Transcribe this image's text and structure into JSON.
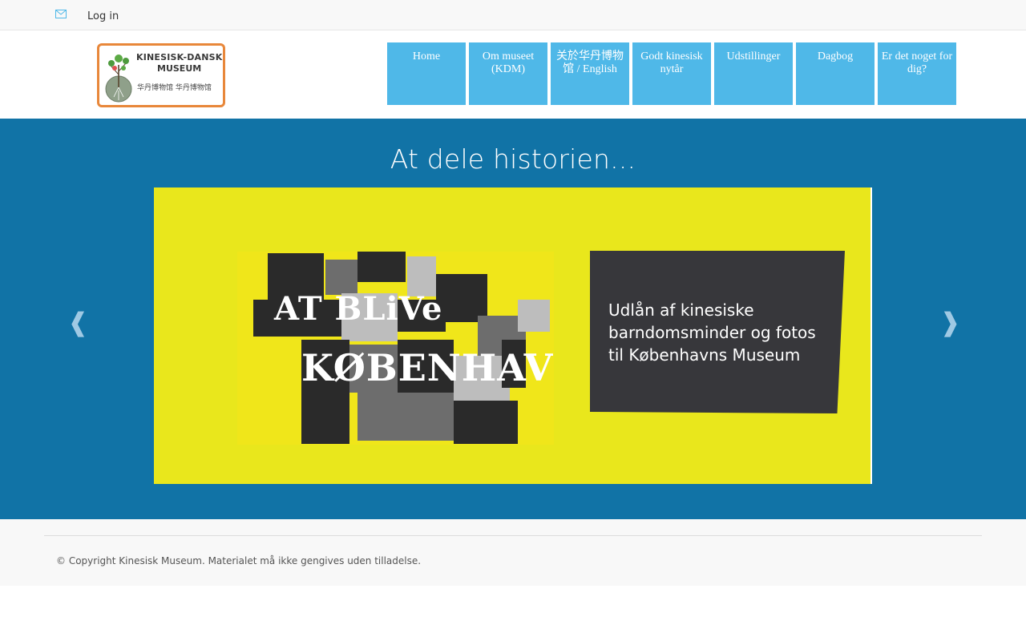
{
  "topbar": {
    "mail_icon": "envelope-icon",
    "login_label": "Log in"
  },
  "header": {
    "logo": {
      "line1": "KINESISK-DANSK",
      "line2": "MUSEUM",
      "line3": "华丹博物馆  华丹博物馆",
      "icon": "tree-icon"
    },
    "nav": [
      {
        "label": "Home"
      },
      {
        "label": "Om museet (KDM)"
      },
      {
        "label": "关於华丹博物馆 / English"
      },
      {
        "label": "Godt kinesisk nytår"
      },
      {
        "label": "Udstillinger"
      },
      {
        "label": "Dagbog"
      },
      {
        "label": "Er det noget for dig?"
      }
    ]
  },
  "hero": {
    "title": "At dele historien...",
    "prev_arrow": "❰",
    "next_arrow": "❱",
    "slide": {
      "collage_line1": "AT BLiVe",
      "collage_line2": "KØBENHAVNER",
      "panel_text": "Udlån af kinesiske\nbarndomsminder og fotos\ntil Københavns Museum"
    }
  },
  "footer": {
    "copyright": "© Copyright Kinesisk Museum. Materialet må ikke gengives uden tilladelse."
  },
  "colors": {
    "nav_bg": "#4fb8e8",
    "hero_bg": "#1173a6",
    "slide_bg": "#e9e71c",
    "panel_bg": "#37373b",
    "logo_border": "#e8873a"
  }
}
